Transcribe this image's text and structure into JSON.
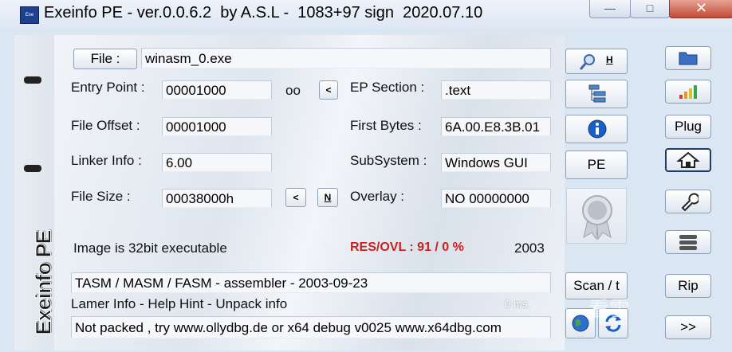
{
  "window": {
    "title": "Exeinfo PE - ver.0.0.6.2  by A.S.L -  1083+97 sign  2020.07.10",
    "app_icon_label": "Exe",
    "minimize": "—",
    "maximize": "□",
    "close": "✕"
  },
  "brand": "Exeinfo PE",
  "file": {
    "button": "File :",
    "name": "winasm_0.exe"
  },
  "fields": {
    "entry_point": {
      "label": "Entry Point :",
      "value": "00001000"
    },
    "oo_label": "oo",
    "lt_button": "<",
    "ep_section": {
      "label": "EP Section :",
      "value": ".text"
    },
    "file_offset": {
      "label": "File Offset :",
      "value": "00001000"
    },
    "first_bytes": {
      "label": "First Bytes :",
      "value": "6A.00.E8.3B.01"
    },
    "linker_info": {
      "label": "Linker Info :",
      "value": "6.00"
    },
    "subsystem": {
      "label": "SubSystem :",
      "value": "Windows GUI"
    },
    "file_size": {
      "label": "File Size :",
      "value": "00038000h"
    },
    "size_lt_button": "<",
    "size_n_button": "N",
    "overlay": {
      "label": "Overlay :",
      "value": "NO   00000000"
    }
  },
  "status": {
    "image_info": "Image is 32bit executable",
    "res_ovl": "RES/OVL : 91 / 0 %",
    "year": "2003"
  },
  "detection": "TASM / MASM / FASM - assembler - 2003-09-23",
  "lamer_info": "Lamer Info - Help Hint - Unpack info",
  "ms": "0 ms.",
  "hint": "Not packed , try  www.ollydbg.de or x64 debug v0025 www.x64dbg.com",
  "mid_buttons": {
    "search_label": "H",
    "pe": "PE",
    "scan": "Scan / t"
  },
  "right_buttons": {
    "plug": "Plug",
    "rip": "Rip",
    "next": ">>"
  },
  "watermark": "看雪",
  "colors": {
    "res_red": "#cc2020",
    "close_red": "#c34a36",
    "info_blue": "#1a5fc8"
  }
}
